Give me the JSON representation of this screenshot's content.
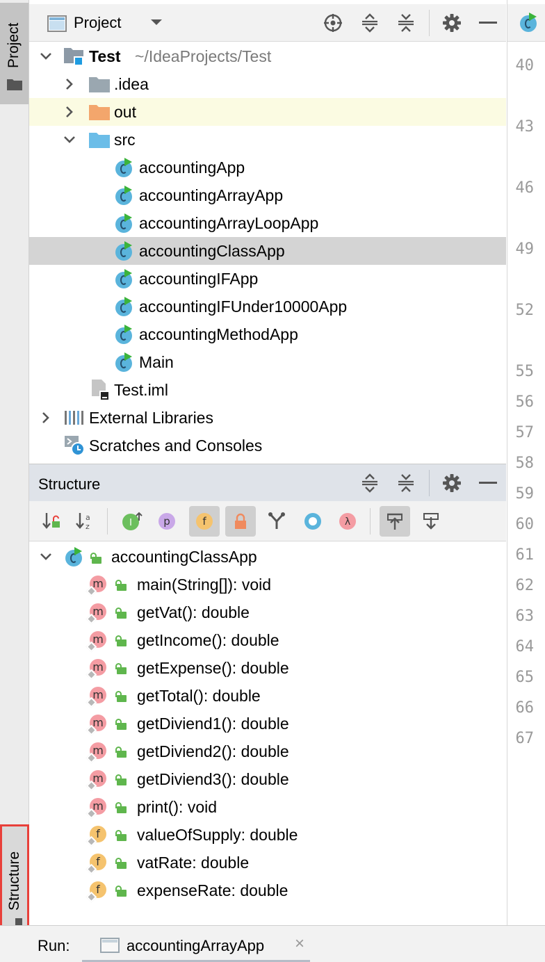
{
  "left_strip": {
    "project_tab": "Project",
    "structure_tab": "Structure"
  },
  "project_panel": {
    "title": "Project",
    "tree": [
      {
        "label": "Test",
        "suffix": "~/IdeaProjects/Test"
      },
      {
        "label": ".idea"
      },
      {
        "label": "out"
      },
      {
        "label": "src"
      },
      {
        "label": "accountingApp"
      },
      {
        "label": "accountingArrayApp"
      },
      {
        "label": "accountingArrayLoopApp"
      },
      {
        "label": "accountingClassApp"
      },
      {
        "label": "accountingIFApp"
      },
      {
        "label": "accountingIFUnder10000App"
      },
      {
        "label": "accountingMethodApp"
      },
      {
        "label": "Main"
      },
      {
        "label": "Test.iml"
      },
      {
        "label": "External Libraries"
      },
      {
        "label": "Scratches and Consoles"
      }
    ]
  },
  "gutter": {
    "tab_icon": "class-icon",
    "line_numbers": [
      "40",
      "43",
      "46",
      "49",
      "52",
      "55",
      "56",
      "57",
      "58",
      "59",
      "60",
      "61",
      "62",
      "63",
      "64",
      "65",
      "66",
      "67"
    ]
  },
  "structure_panel": {
    "title": "Structure",
    "root": "accountingClassApp",
    "members": [
      {
        "label": "main(String[]): void",
        "kind": "method"
      },
      {
        "label": "getVat(): double",
        "kind": "method"
      },
      {
        "label": "getIncome(): double",
        "kind": "method"
      },
      {
        "label": "getExpense(): double",
        "kind": "method"
      },
      {
        "label": "getTotal(): double",
        "kind": "method"
      },
      {
        "label": "getDiviend1(): double",
        "kind": "method"
      },
      {
        "label": "getDiviend2(): double",
        "kind": "method"
      },
      {
        "label": "getDiviend3(): double",
        "kind": "method"
      },
      {
        "label": "print(): void",
        "kind": "method"
      },
      {
        "label": "valueOfSupply: double",
        "kind": "field"
      },
      {
        "label": "vatRate: double",
        "kind": "field"
      },
      {
        "label": "expenseRate: double",
        "kind": "field"
      }
    ],
    "icon_letters": {
      "method": "m",
      "field": "f"
    }
  },
  "toolbar_glyphs": {
    "sort_alpha": "z",
    "interface": "I",
    "property": "p",
    "field": "f",
    "lambda": "λ",
    "class_c": "C"
  },
  "run_bar": {
    "label": "Run:",
    "tab_name": "accountingArrayApp",
    "close": "×"
  },
  "colors": {
    "selection": "#d4d4d4",
    "excluded_folder_bg": "#fbfbe2",
    "source_folder": "#6bbde8",
    "out_folder": "#f3a66c",
    "highlight_border": "#e8403a"
  }
}
